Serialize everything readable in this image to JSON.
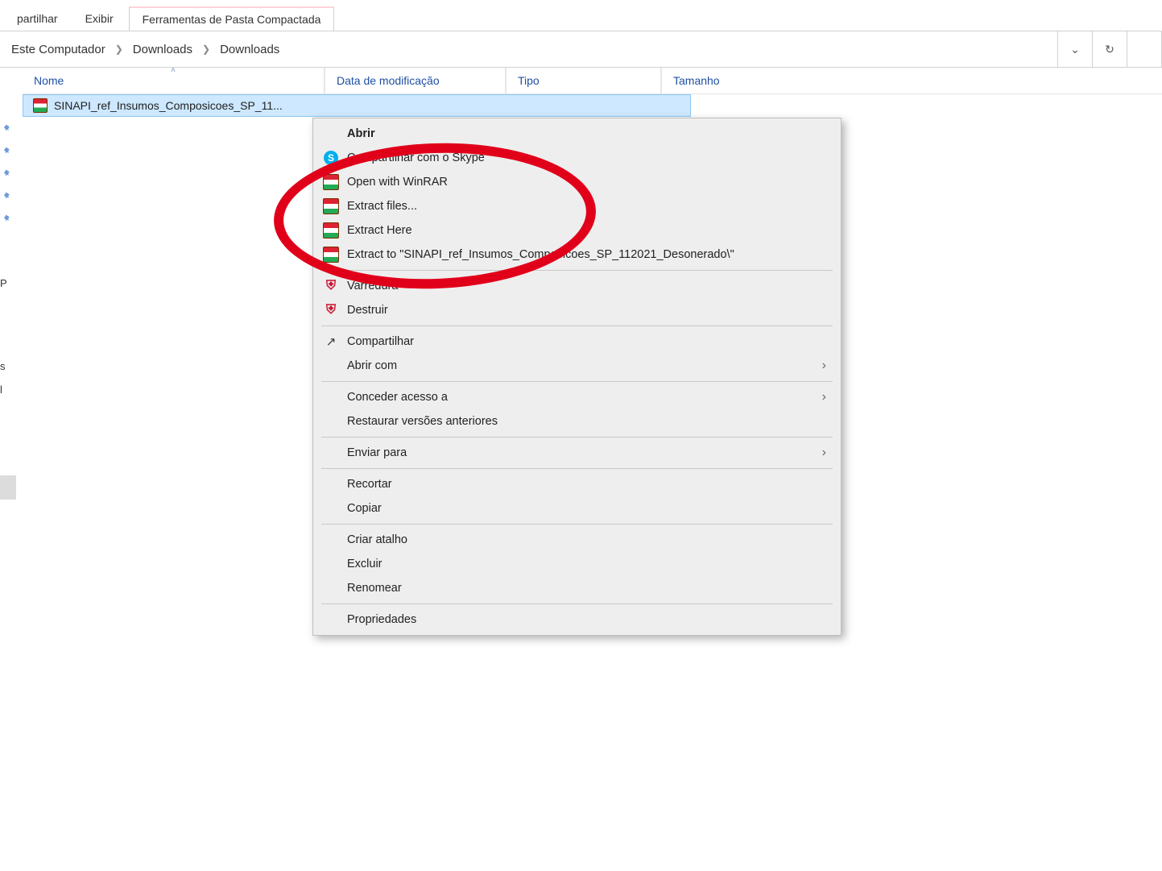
{
  "ribbon": {
    "tab_share": "partilhar",
    "tab_view": "Exibir",
    "tab_tools": "Ferramentas de Pasta Compactada"
  },
  "breadcrumb": {
    "seg0": "Este Computador",
    "seg1": "Downloads",
    "seg2": "Downloads"
  },
  "columns": {
    "name": "Nome",
    "date": "Data de modificação",
    "type": "Tipo",
    "size": "Tamanho"
  },
  "nav": {
    "item0": "P",
    "item1": "s",
    "item2": "l"
  },
  "file": {
    "name": "SINAPI_ref_Insumos_Composicoes_SP_11..."
  },
  "context_menu": {
    "open": "Abrir",
    "skype": "Compartilhar com o Skype",
    "open_winrar": "Open with WinRAR",
    "extract_files": "Extract files...",
    "extract_here": "Extract Here",
    "extract_to": "Extract to \"SINAPI_ref_Insumos_Composicoes_SP_112021_Desonerado\\\"",
    "varredura": "Varredura",
    "destruir": "Destruir",
    "compartilhar": "Compartilhar",
    "abrir_com": "Abrir com",
    "conceder": "Conceder acesso a",
    "restaurar": "Restaurar versões anteriores",
    "enviar": "Enviar para",
    "recortar": "Recortar",
    "copiar": "Copiar",
    "atalho": "Criar atalho",
    "excluir": "Excluir",
    "renomear": "Renomear",
    "propriedades": "Propriedades"
  },
  "icons": {
    "skype_letter": "S"
  }
}
